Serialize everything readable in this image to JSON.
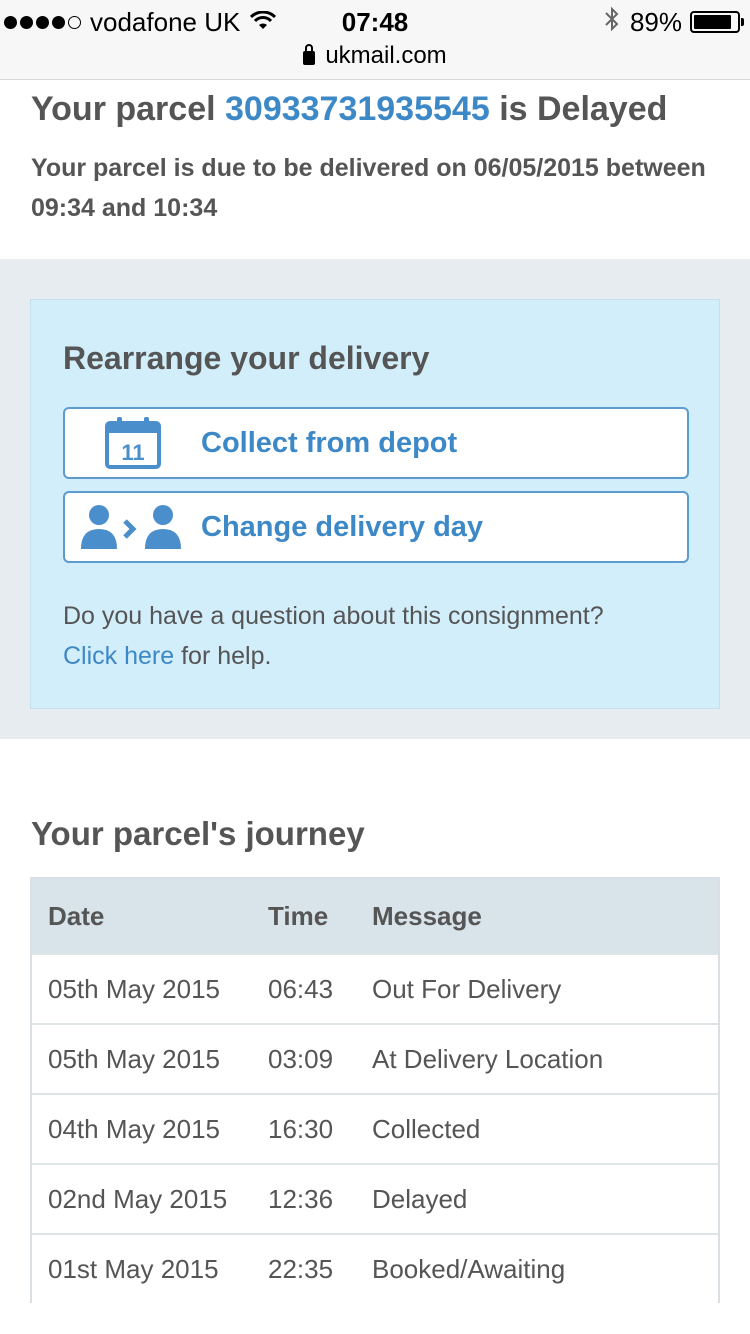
{
  "status_bar": {
    "carrier": "vodafone UK",
    "time": "07:48",
    "battery_percent": "89%",
    "battery_level": 0.89,
    "url": "ukmail.com"
  },
  "header": {
    "title_prefix": "Your parcel",
    "parcel_number": "30933731935545",
    "title_suffix": "is Delayed",
    "due_text": "Your parcel is due to be delivered on 06/05/2015 between 09:34 and 10:34"
  },
  "rearrange": {
    "title": "Rearrange your delivery",
    "collect_label": "Collect from depot",
    "calendar_day": "11",
    "change_day_label": "Change delivery day",
    "question_text": "Do you have a question about this consignment?",
    "help_link": "Click here",
    "help_suffix": "for help."
  },
  "journey": {
    "title": "Your parcel's journey",
    "columns": [
      "Date",
      "Time",
      "Message"
    ],
    "rows": [
      {
        "date": "05th May 2015",
        "time": "06:43",
        "message": "Out For Delivery"
      },
      {
        "date": "05th May 2015",
        "time": "03:09",
        "message": "At Delivery Location"
      },
      {
        "date": "04th May 2015",
        "time": "16:30",
        "message": "Collected"
      },
      {
        "date": "02nd May 2015",
        "time": "12:36",
        "message": "Delayed"
      },
      {
        "date": "01st May 2015",
        "time": "22:35",
        "message": "Booked/Awaiting"
      }
    ]
  },
  "colors": {
    "accent": "#3d88c6",
    "panel_blue": "#d2eefa",
    "band_grey": "#e6ecef"
  }
}
